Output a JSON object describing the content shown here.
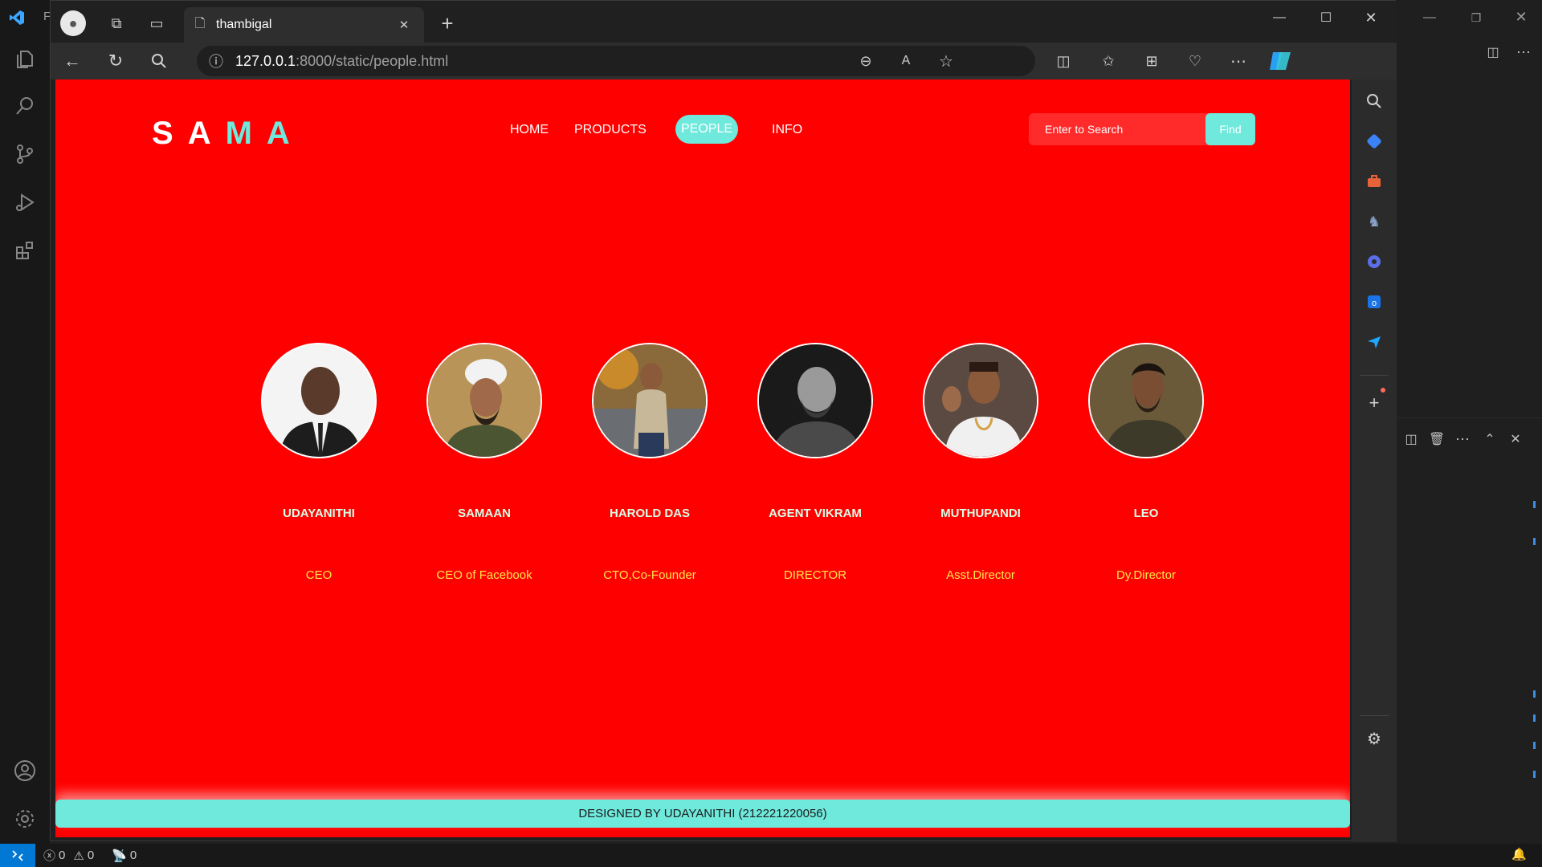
{
  "browser": {
    "tab_title": "thambigal",
    "url_host": "127.0.0.1",
    "url_rest": ":8000/static/people.html"
  },
  "site": {
    "logo_letters": [
      "S",
      "A",
      "M",
      "A"
    ],
    "logo_colors": [
      "#ffffff",
      "#ffffff",
      "#6fe9dc",
      "#6fe9dc"
    ],
    "nav": {
      "home": "HOME",
      "products": "PRODUCTS",
      "people": "PEOPLE",
      "info": "INFO"
    },
    "search": {
      "placeholder": "Enter to Search",
      "button": "Find"
    },
    "people": [
      {
        "name": "UDAYANITHI",
        "role": "CEO"
      },
      {
        "name": "SAMAAN",
        "role": "CEO of Facebook"
      },
      {
        "name": "HAROLD DAS",
        "role": "CTO,Co-Founder"
      },
      {
        "name": "AGENT VIKRAM",
        "role": "DIRECTOR"
      },
      {
        "name": "MUTHUPANDI",
        "role": "Asst.Director"
      },
      {
        "name": "LEO",
        "role": "Dy.Director"
      }
    ],
    "footer": "DESIGNED BY UDAYANITHI (212221220056)"
  },
  "vscode": {
    "status": {
      "errors": "0",
      "warnings": "0",
      "ports": "0"
    },
    "title_fragment": "Fi"
  },
  "colors": {
    "page_bg": "#ff0000",
    "accent": "#6fe9dc",
    "name_text": "#d8ffe8",
    "role_text": "#ffe84a"
  }
}
